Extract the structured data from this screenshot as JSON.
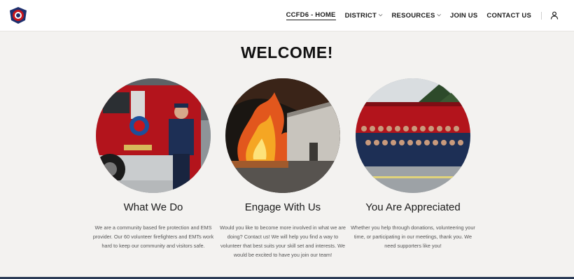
{
  "header": {
    "logo_icon": "fire-department-badge-icon",
    "nav": [
      {
        "label": "CCFD6 - HOME",
        "active": true,
        "dropdown": false
      },
      {
        "label": "DISTRICT",
        "active": false,
        "dropdown": true
      },
      {
        "label": "RESOURCES",
        "active": false,
        "dropdown": true
      },
      {
        "label": "JOIN US",
        "active": false,
        "dropdown": false
      },
      {
        "label": "CONTACT US",
        "active": false,
        "dropdown": false
      }
    ],
    "account_icon": "user-icon"
  },
  "main": {
    "title": "WELCOME!",
    "columns": [
      {
        "image": "firefighter-beside-fire-engine-photo",
        "title": "What We Do",
        "text": "We are a community based fire protection and EMS provider.  Our 60 volunteer firefighters and EMTs work hard to keep our community and visitors safe."
      },
      {
        "image": "building-fire-at-night-photo",
        "title": "Engage With Us",
        "text": "Would you like to become more involved in what we are doing?  Contact us!  We will help you find a way to volunteer that best suits your skill set and interests.  We would be excited to have you join our team!"
      },
      {
        "image": "volunteer-group-in-front-of-engines-photo",
        "title": "You Are Appreciated",
        "text": "Whether you help through donations, volunteering your time, or participating in our meetings, thank you.  We need supporters like you!"
      }
    ]
  },
  "colors": {
    "header_bg": "#ffffff",
    "page_bg": "#f3f2f0",
    "fire_red": "#b3141c",
    "navy": "#1d2f55"
  }
}
